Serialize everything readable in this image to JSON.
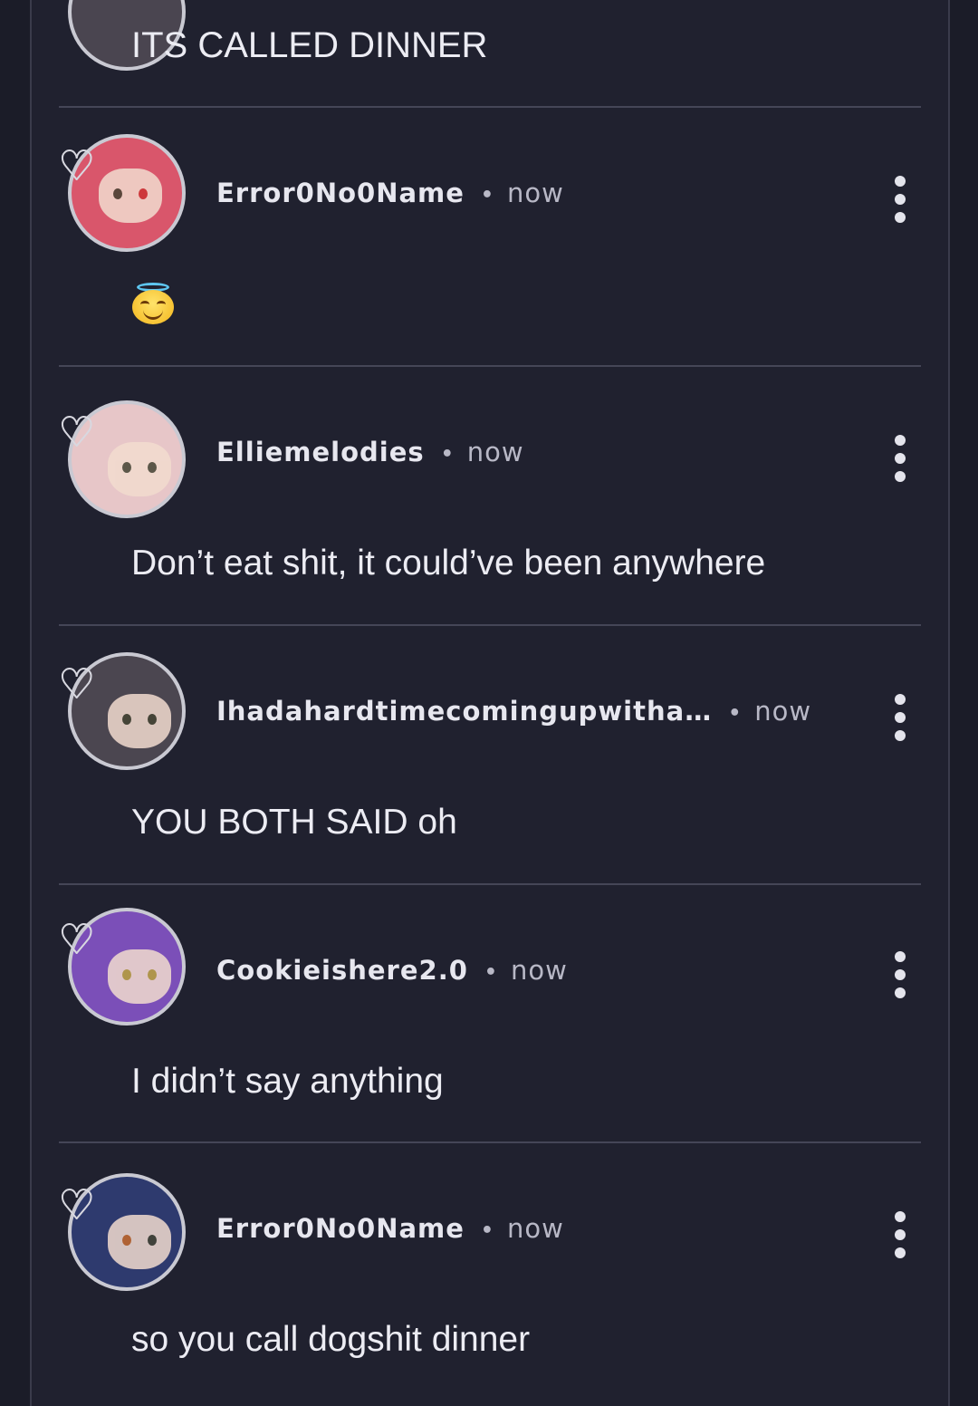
{
  "top_comment": {
    "body": "ITS CALLED DINNER",
    "avatar_color": "#4a4550"
  },
  "comments": [
    {
      "username": "Error0No0Name",
      "separator": "•",
      "time": "now",
      "body": "",
      "body_emoji": "smiling-face-with-halo",
      "avatar_color": "#d9566b",
      "avatar_accent": "#e8b23a"
    },
    {
      "username": "Elliemelodies",
      "separator": "•",
      "time": "now",
      "body": "Don’t eat shit, it could’ve been anywhere",
      "avatar_color": "#e7c6c8",
      "avatar_accent": "#d23b3b"
    },
    {
      "username": "Ihadahardtimecomingupwitha…",
      "separator": "•",
      "time": "now",
      "body": "YOU BOTH SAID oh",
      "avatar_color": "#4b4650",
      "avatar_accent": "#e8b58c"
    },
    {
      "username": "Cookieishere2.0",
      "separator": "•",
      "time": "now",
      "body": "I didn’t say anything",
      "avatar_color": "#7b4fb8",
      "avatar_accent": "#40c6c8"
    },
    {
      "username": "Error0No0Name",
      "separator": "•",
      "time": "now",
      "body": "so you call dogshit dinner",
      "avatar_color": "#2e3a6e",
      "avatar_accent": "#e3c45a"
    }
  ],
  "colors": {
    "background": "#1b1c28",
    "panel": "#20212f",
    "divider": "#454657",
    "text": "#ececf3",
    "muted": "#b8b8c6"
  }
}
